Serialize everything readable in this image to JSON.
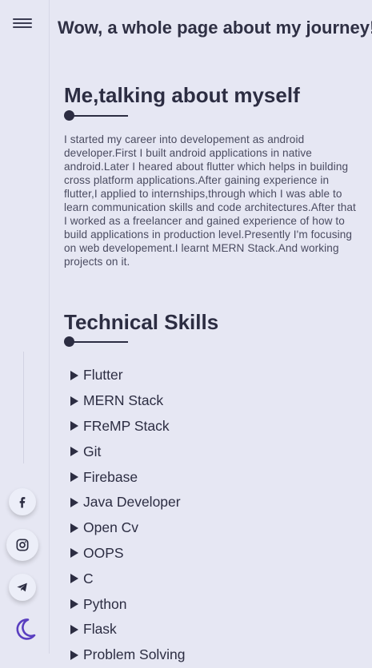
{
  "sidebar": {
    "menu_icon": "hamburger-menu-icon",
    "socials": [
      {
        "name": "facebook",
        "icon": "facebook-icon"
      },
      {
        "name": "instagram",
        "icon": "instagram-icon"
      },
      {
        "name": "telegram",
        "icon": "telegram-icon"
      }
    ],
    "theme_toggle_icon": "moon-icon",
    "accent_color": "#5a3fc0"
  },
  "header": {
    "title": "Wow, a whole page about my journey!"
  },
  "about": {
    "heading": "Me,talking about myself",
    "text": "I started my career into developement as android developer.First I built android applications in native android.Later I heared about flutter which helps in building cross platform applications.After gaining experience in flutter,I applied to internships,through which I was able to learn communication skills and code architectures.After that I worked as a freelancer and gained experience of how to build applications in production level.Presently I'm focusing on web developement.I learnt MERN Stack.And working projects on it."
  },
  "skills": {
    "heading": "Technical Skills",
    "items": [
      "Flutter",
      "MERN Stack",
      "FReMP Stack",
      "Git",
      "Firebase",
      "Java Developer",
      "Open Cv",
      "OOPS",
      "C",
      "Python",
      "Flask",
      "Problem Solving"
    ]
  }
}
